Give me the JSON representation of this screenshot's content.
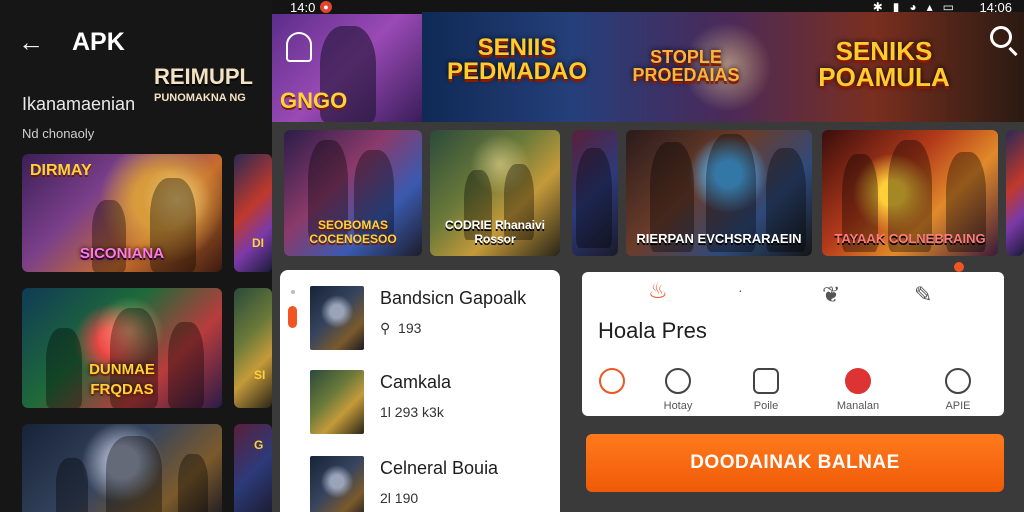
{
  "colors": {
    "accent": "#f05523",
    "button": "#f86b12",
    "panel": "#ffffff",
    "background": "#161616"
  },
  "status_bar": {
    "time_left": "14:0",
    "time_right": "14:06",
    "icons": [
      "bluetooth-icon",
      "vibrate-icon",
      "wifi-icon",
      "signal-icon",
      "battery-icon"
    ]
  },
  "header": {
    "title": "APK",
    "back_icon": "arrow-left-icon"
  },
  "left": {
    "section_title": "Ikanamaenian",
    "section_sub": "Nd chonaoly",
    "overlay_logo_top": "REIMUPL",
    "overlay_logo_bottom": "PUNOMAKNA NG",
    "tiles": [
      {
        "caption_top": "DIRMAY",
        "caption": "SICONIANA"
      },
      {
        "caption_top": "DUNMAE",
        "caption": "FRQDAS"
      }
    ],
    "side_tile_captions": [
      "DI",
      "SI",
      "G"
    ]
  },
  "banner": {
    "titles": [
      "SENIIS PEDMADAO",
      "STOPLE PROEDAIAS",
      "SENIKS POAMULA"
    ],
    "avatar_logo": "GNGO"
  },
  "cards": [
    {
      "caption": "SEOBOMAS COCENOESOO"
    },
    {
      "caption": "CODRIE Rhanaivi Rossor"
    },
    {
      "caption": ""
    },
    {
      "caption": "RIERPAN EVCHSRARAEIN"
    },
    {
      "caption": "TAYAAK COLNEBRAING"
    }
  ],
  "list": [
    {
      "title": "Bandsicn Gapoalk",
      "meta": "193"
    },
    {
      "title": "Camkala",
      "meta": "1l 293 k3k"
    },
    {
      "title": "Celneral Bouia",
      "meta": "2l 190"
    }
  ],
  "details": {
    "name": "Hoala Pres",
    "nav": [
      {
        "label": ""
      },
      {
        "label": "Hotay"
      },
      {
        "label": "Poile"
      },
      {
        "label": "Manalan"
      },
      {
        "label": "APIE"
      }
    ]
  },
  "download_label": "DOODAINAK BALNAE"
}
